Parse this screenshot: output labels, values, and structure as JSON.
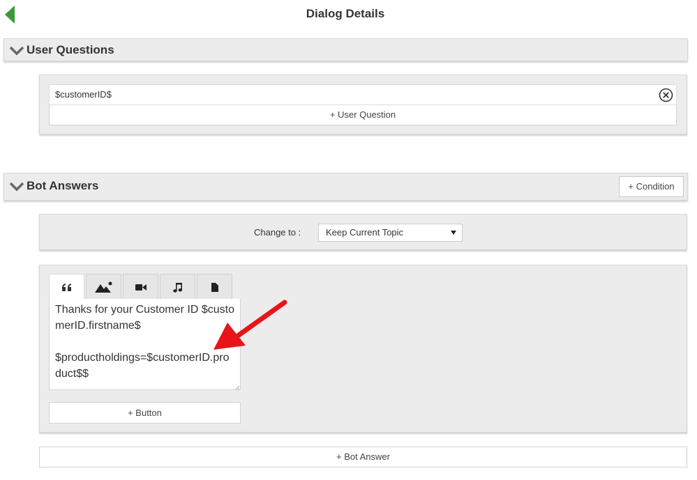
{
  "page": {
    "title": "Dialog Details"
  },
  "icons": {
    "back": "back-arrow-icon",
    "chevron": "chevron-down-icon",
    "remove": "remove-circle-x-icon",
    "quote": "quote-icon",
    "image": "image-icon",
    "video": "video-camera-icon",
    "audio": "music-note-icon",
    "file": "file-icon"
  },
  "colors": {
    "back_arrow": "#3a9a3a",
    "annotation_arrow": "#e8141a",
    "panel_bg": "#ececec"
  },
  "user_questions": {
    "header_label": "User Questions",
    "questions": [
      {
        "text": "$customerID$"
      }
    ],
    "add_label": "+ User Question"
  },
  "bot_answers": {
    "header_label": "Bot Answers",
    "condition_label": "+ Condition",
    "change_to": {
      "label": "Change to :",
      "selected": "Keep Current Topic"
    },
    "answer": {
      "tabs": [
        "quote",
        "image",
        "video",
        "audio",
        "file"
      ],
      "active_tab": "quote",
      "text": "Thanks for your Customer ID $customerID.firstname$\n\n$productholdings=$customerID.product$$",
      "add_button_label": "+ Button"
    },
    "add_answer_label": "+ Bot Answer"
  }
}
